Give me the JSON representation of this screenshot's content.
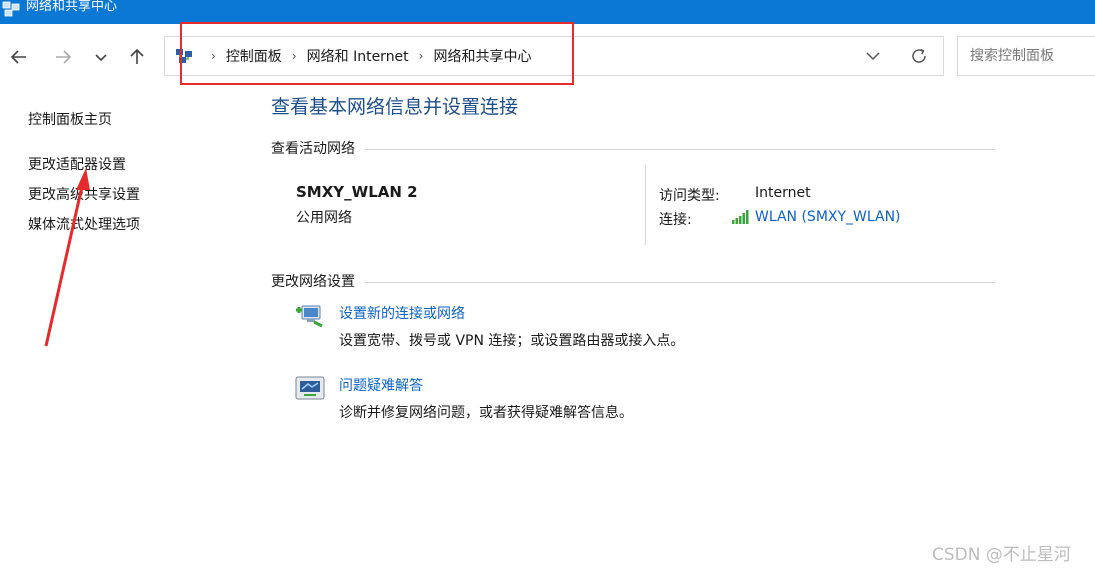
{
  "window": {
    "title": "网络和共享中心"
  },
  "nav": {
    "back_icon": "arrow-left-icon",
    "forward_icon": "arrow-right-icon",
    "recent_icon": "chevron-down-icon",
    "up_icon": "arrow-up-icon"
  },
  "address": {
    "crumbs": [
      "控制面板",
      "网络和 Internet",
      "网络和共享中心"
    ]
  },
  "search": {
    "placeholder": "搜索控制面板"
  },
  "sidebar": {
    "items": [
      {
        "label": "控制面板主页"
      },
      {
        "label": "更改适配器设置"
      },
      {
        "label": "更改高级共享设置"
      },
      {
        "label": "媒体流式处理选项"
      }
    ]
  },
  "main": {
    "title": "查看基本网络信息并设置连接",
    "active_section": "查看活动网络",
    "network": {
      "name": "SMXY_WLAN 2",
      "type": "公用网络",
      "access_label": "访问类型:",
      "access_value": "Internet",
      "connection_label": "连接:",
      "connection_value": "WLAN (SMXY_WLAN)"
    },
    "change_section": "更改网络设置",
    "tasks": [
      {
        "link": "设置新的连接或网络",
        "desc": "设置宽带、拨号或 VPN 连接；或设置路由器或接入点。"
      },
      {
        "link": "问题疑难解答",
        "desc": "诊断并修复网络问题，或者获得疑难解答信息。"
      }
    ]
  },
  "watermark": "CSDN @不止星河",
  "colors": {
    "titlebar": "#0a78d4",
    "link": "#0b63c4",
    "heading": "#1e4e8c",
    "annotation": "#e52b2b"
  }
}
